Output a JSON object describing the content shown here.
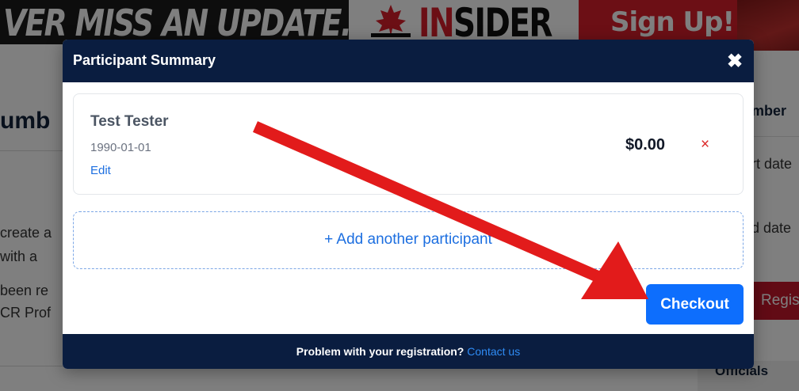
{
  "banner": {
    "headline": "VER MISS AN UPDATE.",
    "brand_prefix": "IN",
    "brand_suffix": "SIDER",
    "signup_label": "Sign Up!"
  },
  "background": {
    "left_title": "umb",
    "left_text": [
      "create a",
      "with a",
      "been re",
      "CR Prof"
    ],
    "right_labels": [
      "mber",
      "rt date",
      "d date"
    ],
    "register_label": "Regis",
    "officials_label": "Officials"
  },
  "modal": {
    "title": "Participant Summary",
    "close_icon": "close-icon",
    "participant": {
      "name": "Test Tester",
      "dob": "1990-01-01",
      "edit_label": "Edit",
      "price": "$0.00",
      "remove_icon": "×"
    },
    "add_participant_label": "+ Add another participant",
    "checkout_label": "Checkout",
    "footer": {
      "text": "Problem with your registration?",
      "link_label": "Contact us"
    }
  },
  "colors": {
    "header_navy": "#0a1d40",
    "primary_blue": "#0d6efd",
    "link_blue": "#1d6fe0",
    "danger_red": "#dc2626",
    "annotation_red": "#e21b1b"
  }
}
